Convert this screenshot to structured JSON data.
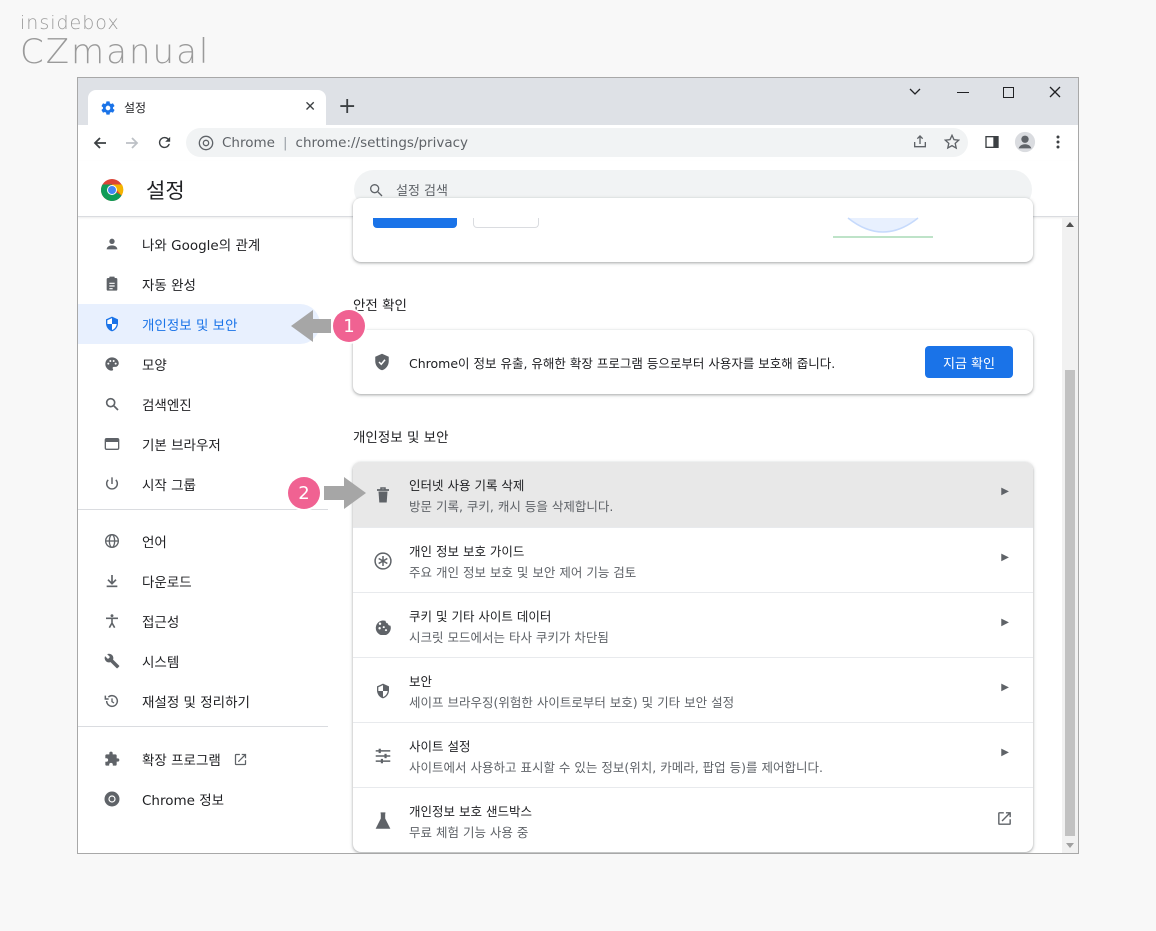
{
  "watermark": {
    "line1": "insidebox",
    "line2": "CZmanual"
  },
  "browser": {
    "tab_title": "설정",
    "tab_close": "✕",
    "new_tab": "+",
    "window_controls": {
      "minimize": "—",
      "maximize": "☐",
      "close": "✕",
      "tab_search": "⌄"
    },
    "site_name": "Chrome",
    "url": "chrome://settings/privacy"
  },
  "header": {
    "title": "설정",
    "search_placeholder": "설정 검색"
  },
  "sidebar": {
    "items": [
      {
        "label": "나와 Google의 관계",
        "icon": "person-icon"
      },
      {
        "label": "자동 완성",
        "icon": "clipboard-icon"
      },
      {
        "label": "개인정보 및 보안",
        "icon": "shield-icon",
        "active": true
      },
      {
        "label": "모양",
        "icon": "palette-icon"
      },
      {
        "label": "검색엔진",
        "icon": "search-icon"
      },
      {
        "label": "기본 브라우저",
        "icon": "browser-icon"
      },
      {
        "label": "시작 그룹",
        "icon": "power-icon"
      },
      {
        "label": "언어",
        "icon": "globe-icon"
      },
      {
        "label": "다운로드",
        "icon": "download-icon"
      },
      {
        "label": "접근성",
        "icon": "accessibility-icon"
      },
      {
        "label": "시스템",
        "icon": "wrench-icon"
      },
      {
        "label": "재설정 및 정리하기",
        "icon": "restore-icon"
      },
      {
        "label": "확장 프로그램",
        "icon": "puzzle-icon"
      },
      {
        "label": "Chrome 정보",
        "icon": "chrome-icon"
      }
    ]
  },
  "main": {
    "safety_check": {
      "title": "안전 확인",
      "description": "Chrome이 정보 유출, 유해한 확장 프로그램 등으로부터 사용자를 보호해 줍니다.",
      "button": "지금 확인"
    },
    "privacy": {
      "title": "개인정보 및 보안",
      "rows": [
        {
          "title": "인터넷 사용 기록 삭제",
          "subtitle": "방문 기록, 쿠키, 캐시 등을 삭제합니다.",
          "icon": "trash-icon"
        },
        {
          "title": "개인 정보 보호 가이드",
          "subtitle": "주요 개인 정보 보호 및 보안 제어 기능 검토",
          "icon": "guide-icon"
        },
        {
          "title": "쿠키 및 기타 사이트 데이터",
          "subtitle": "시크릿 모드에서는 타사 쿠키가 차단됨",
          "icon": "cookie-icon"
        },
        {
          "title": "보안",
          "subtitle": "세이프 브라우징(위험한 사이트로부터 보호) 및 기타 보안 설정",
          "icon": "shield-icon"
        },
        {
          "title": "사이트 설정",
          "subtitle": "사이트에서 사용하고 표시할 수 있는 정보(위치, 카메라, 팝업 등)를 제어합니다.",
          "icon": "tune-icon"
        },
        {
          "title": "개인정보 보호 샌드박스",
          "subtitle": "무료 체험 기능 사용 중",
          "icon": "flask-icon"
        }
      ]
    }
  },
  "annotations": {
    "badge1": "1",
    "badge2": "2"
  },
  "colors": {
    "accent": "#1a73e8",
    "badge": "#f06292",
    "arrow": "#a6a6a6"
  }
}
